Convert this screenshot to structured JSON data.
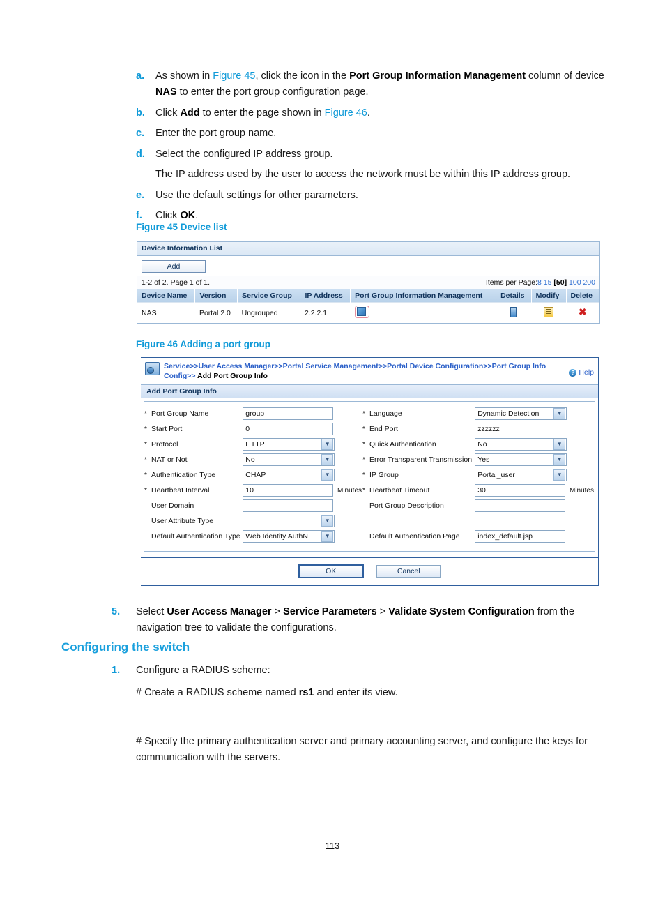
{
  "steps_letter": [
    {
      "marker": "a.",
      "segments": [
        {
          "t": "As shown in ",
          "s": "n"
        },
        {
          "t": "Figure 45",
          "s": "a"
        },
        {
          "t": ", click the icon in the ",
          "s": "n"
        },
        {
          "t": "Port Group Information Management",
          "s": "b"
        },
        {
          "t": " column of device ",
          "s": "n"
        },
        {
          "t": "NAS",
          "s": "b"
        },
        {
          "t": " to enter the port group configuration page.",
          "s": "n"
        }
      ]
    },
    {
      "marker": "b.",
      "segments": [
        {
          "t": "Click ",
          "s": "n"
        },
        {
          "t": "Add",
          "s": "b"
        },
        {
          "t": " to enter the page shown in ",
          "s": "n"
        },
        {
          "t": "Figure 46",
          "s": "a"
        },
        {
          "t": ".",
          "s": "n"
        }
      ]
    },
    {
      "marker": "c.",
      "segments": [
        {
          "t": "Enter the port group name.",
          "s": "n"
        }
      ]
    },
    {
      "marker": "d.",
      "segments": [
        {
          "t": "Select the configured IP address group.",
          "s": "n"
        }
      ],
      "continuation": "The IP address used by the user to access the network must be within this IP address group."
    },
    {
      "marker": "e.",
      "segments": [
        {
          "t": "Use the default settings for other parameters.",
          "s": "n"
        }
      ]
    },
    {
      "marker": "f.",
      "segments": [
        {
          "t": "Click ",
          "s": "n"
        },
        {
          "t": "OK",
          "s": "b"
        },
        {
          "t": ".",
          "s": "n"
        }
      ]
    }
  ],
  "figure45": {
    "caption": "Figure 45 Device list",
    "panel_title": "Device Information List",
    "add_button": "Add",
    "count_text": "1-2 of 2. Page 1 of 1.",
    "items_per_page_label": "Items per Page:",
    "items_per_page_options": [
      "8",
      "15",
      "50",
      "100",
      "200"
    ],
    "items_per_page_selected": "50",
    "columns": [
      "Device Name",
      "Version",
      "Service Group",
      "IP Address",
      "Port Group Information Management",
      "Details",
      "Modify",
      "Delete"
    ],
    "rows": [
      {
        "device_name": "NAS",
        "version": "Portal 2.0",
        "service_group": "Ungrouped",
        "ip_address": "2.2.2.1",
        "port_group_icon": "port-group-config-icon",
        "details_icon": "details-icon",
        "modify_icon": "modify-icon",
        "delete_icon": "delete-icon"
      }
    ]
  },
  "figure46": {
    "caption": "Figure 46 Adding a port group",
    "breadcrumb": {
      "links": [
        "Service",
        "User Access Manager",
        "Portal Service Management",
        "Portal Device Configuration",
        "Port Group Info Config"
      ],
      "separator": ">>",
      "current_prefix": ">> ",
      "current": "Add Port Group Info"
    },
    "help_label": "Help",
    "panel_title": "Add Port Group Info",
    "left_fields": [
      {
        "required": true,
        "label": "Port Group Name",
        "type": "text",
        "value": "group",
        "unit": ""
      },
      {
        "required": true,
        "label": "Start Port",
        "type": "text",
        "value": "0",
        "unit": ""
      },
      {
        "required": true,
        "label": "Protocol",
        "type": "select",
        "value": "HTTP",
        "unit": ""
      },
      {
        "required": true,
        "label": "NAT or Not",
        "type": "select",
        "value": "No",
        "unit": ""
      },
      {
        "required": true,
        "label": "Authentication Type",
        "type": "select",
        "value": "CHAP",
        "unit": ""
      },
      {
        "required": true,
        "label": "Heartbeat Interval",
        "type": "text",
        "value": "10",
        "unit": "Minutes"
      },
      {
        "required": false,
        "label": "User Domain",
        "type": "text",
        "value": "",
        "unit": ""
      },
      {
        "required": false,
        "label": "User Attribute Type",
        "type": "select",
        "value": "",
        "unit": ""
      },
      {
        "required": false,
        "label": "Default Authentication Type",
        "type": "select",
        "value": "Web Identity AuthN",
        "unit": ""
      }
    ],
    "right_fields": [
      {
        "required": true,
        "label": "Language",
        "type": "select",
        "value": "Dynamic Detection",
        "unit": ""
      },
      {
        "required": true,
        "label": "End Port",
        "type": "text",
        "value": "zzzzzz",
        "unit": ""
      },
      {
        "required": true,
        "label": "Quick Authentication",
        "type": "select",
        "value": "No",
        "unit": ""
      },
      {
        "required": true,
        "label": "Error Transparent Transmission",
        "type": "select",
        "value": "Yes",
        "unit": ""
      },
      {
        "required": true,
        "label": "IP Group",
        "type": "select",
        "value": "Portal_user",
        "unit": ""
      },
      {
        "required": true,
        "label": "Heartbeat Timeout",
        "type": "text",
        "value": "30",
        "unit": "Minutes"
      },
      {
        "required": false,
        "label": "Port Group Description",
        "type": "text",
        "value": "",
        "unit": ""
      },
      {
        "required": false,
        "label": "",
        "type": "none",
        "value": "",
        "unit": ""
      },
      {
        "required": false,
        "label": "Default Authentication Page",
        "type": "text",
        "value": "index_default.jsp",
        "unit": ""
      }
    ],
    "ok_label": "OK",
    "cancel_label": "Cancel"
  },
  "step5": {
    "marker": "5.",
    "segments": [
      {
        "t": "Select ",
        "s": "n"
      },
      {
        "t": "User Access Manager",
        "s": "b"
      },
      {
        "t": " > ",
        "s": "n"
      },
      {
        "t": "Service Parameters",
        "s": "b"
      },
      {
        "t": " > ",
        "s": "n"
      },
      {
        "t": "Validate System Configuration",
        "s": "b"
      },
      {
        "t": " from the navigation tree to validate the configurations.",
        "s": "n"
      }
    ]
  },
  "section_heading": "Configuring the switch",
  "step1": {
    "marker": "1.",
    "segments": [
      {
        "t": "Configure a RADIUS scheme:",
        "s": "n"
      }
    ]
  },
  "comment1": {
    "segments": [
      {
        "t": "# Create a RADIUS scheme named ",
        "s": "n"
      },
      {
        "t": "rs1",
        "s": "b"
      },
      {
        "t": " and enter its view.",
        "s": "n"
      }
    ]
  },
  "comment2": {
    "segments": [
      {
        "t": "# Specify the primary authentication server and primary accounting server, and configure the keys for communication with the servers.",
        "s": "n"
      }
    ]
  },
  "page_number": "113",
  "colors": {
    "accent": "#0f9ad8",
    "heading": "#1aa0dd",
    "link": "#2a5fc8",
    "panel_border": "#2f5f9e",
    "required_mark": "#c05fb0",
    "delete_red": "#cf2020"
  }
}
